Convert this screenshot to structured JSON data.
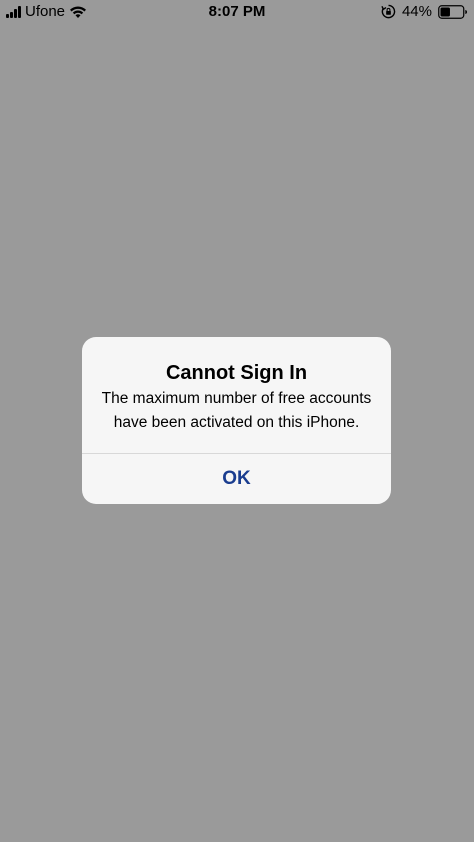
{
  "status_bar": {
    "carrier": "Ufone",
    "time": "8:07 PM",
    "battery_percent": "44%",
    "battery_level": 0.44,
    "icons": [
      "signal-icon",
      "wifi-icon",
      "orientation-lock-icon",
      "battery-icon"
    ]
  },
  "alert": {
    "title": "Cannot Sign In",
    "message_line1": "The maximum number of free accounts",
    "message_line2": "have been activated on this iPhone.",
    "button_label": "OK"
  },
  "colors": {
    "background": "#9a9a9a",
    "alert_background": "#f6f6f6",
    "button_text": "#1a3d8f"
  }
}
